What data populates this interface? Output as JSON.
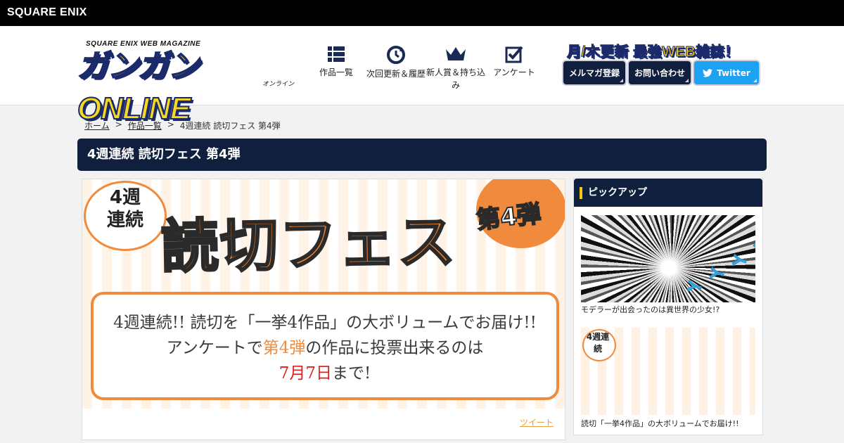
{
  "brand": {
    "name": "SQUARE ENIX"
  },
  "site": {
    "logo_sub": "SQUARE ENIX WEB MAGAZINE",
    "logo_main": "ガンガンONLINE",
    "logo_kana": "オンライン",
    "tagline": "月/木更新 最強WEB雑誌！"
  },
  "nav": [
    {
      "label": "作品一覧",
      "icon": "grid-list-icon"
    },
    {
      "label": "次回更新＆履歴",
      "icon": "history-clock-icon"
    },
    {
      "label": "新人賞＆持ち込み",
      "icon": "crown-icon"
    },
    {
      "label": "アンケート",
      "icon": "checkbox-icon"
    }
  ],
  "header_buttons": {
    "mailmag": "メルマガ登録",
    "contact": "お問い合わせ",
    "twitter": "Twitter"
  },
  "breadcrumb": {
    "home": "ホーム",
    "works": "作品一覧",
    "current": "4週連続 読切フェス 第4弾",
    "separator": ">"
  },
  "page": {
    "title": "4週連続 読切フェス 第4弾"
  },
  "banner": {
    "bubble": "4週連続",
    "title": "読切フェス",
    "round": "第4弾",
    "line1": "4週連続!! 読切を「一挙4作品」の大ボリュームでお届け!!",
    "line2_pre": "アンケートで",
    "line2_hl": "第4弾",
    "line2_post": "の作品に投票出来るのは",
    "line3_hl": "7月7日",
    "line3_post": "まで!"
  },
  "tweet_label": "ツイート",
  "sidebar": {
    "heading": "ピックアップ",
    "items": [
      {
        "caption": "モデラーが出会ったのは異世界の少女!?",
        "sfx": "シィィィ"
      },
      {
        "caption": "読切「一挙4作品」の大ボリュームでお届け!!",
        "bubble": "4週連続"
      }
    ]
  },
  "colors": {
    "navy": "#0f1f3d",
    "orange": "#f08a3c",
    "twitter": "#1da1f2",
    "accent_yellow": "#f5c518",
    "deadline_red": "#e02020"
  }
}
